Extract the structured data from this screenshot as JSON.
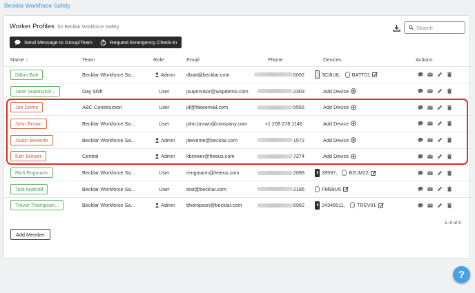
{
  "breadcrumb": "Becklar Workforce Safety",
  "card": {
    "title": "Worker Profiles",
    "subtitle": "for Becklar Workforce Safety",
    "send_message_label": "Send Message to Group/Team",
    "emergency_label": "Request Emergency Check-In",
    "search_placeholder": "Search"
  },
  "columns": {
    "name": "Name",
    "team": "Team",
    "role": "Role",
    "email": "Email",
    "phone": "Phone",
    "devices": "Devices",
    "actions": "Actions"
  },
  "add_device_label": "Add Device",
  "rows": [
    {
      "name": "Dillon Batt",
      "team": "Becklar Workforce Sa...",
      "role": "Admin",
      "email": "dbatt@becklar.com",
      "phone_suffix": "0092",
      "devices": [
        {
          "type": "tracker",
          "label": "3CI8U8,"
        },
        {
          "type": "tag",
          "label": "BATT01"
        }
      ],
      "highlight": false
    },
    {
      "name": "Jane Supervisor...",
      "team": "Day Shift",
      "role": "User",
      "email": "jsupervisor@wspdemo.com",
      "phone_suffix": "2303",
      "devices": [],
      "highlight": false
    },
    {
      "name": "Joe Demo",
      "team": "ABC Construction",
      "role": "User",
      "email": "jd@fakeemail.com",
      "phone_suffix": "5555",
      "devices": [],
      "highlight": true
    },
    {
      "name": "John Brown",
      "team": "Becklar Workforce Sa...",
      "role": "User",
      "email": "john.brown@company.com",
      "phone_full": "+1 208 278 1146",
      "devices": [],
      "highlight": true
    },
    {
      "name": "Justin Bevente",
      "team": "Becklar Workforce Sa...",
      "role": "Admin",
      "email": "jbevente@becklar.com",
      "phone_suffix": "1572",
      "devices": [],
      "highlight": true
    },
    {
      "name": "Ken Brower",
      "team": "Central",
      "role": "Admin",
      "email": "kbrower@freeus.com",
      "phone_suffix": "7274",
      "devices": [],
      "highlight": true
    },
    {
      "name": "Rich Engmann",
      "team": "Becklar Workforce Sa...",
      "role": "User",
      "email": "rengmann@freeus.com",
      "phone_suffix": "2098",
      "devices": [
        {
          "type": "tracker-dark",
          "label": "28597,"
        },
        {
          "type": "tag",
          "label": "B2UM22"
        }
      ],
      "highlight": false
    },
    {
      "name": "Test Android",
      "team": "Becklar Workforce Sa...",
      "role": "User",
      "email": "test@becklar.com",
      "phone_suffix": "2185",
      "devices": [
        {
          "type": "tag",
          "label": "FM99U5"
        }
      ],
      "highlight": false
    },
    {
      "name": "Trevor Thompson...",
      "team": "Becklar Workforce Sa...",
      "role": "Admin",
      "email": "tthompson@becklar.com",
      "phone_suffix": "6962",
      "devices": [
        {
          "type": "tracker-dark",
          "label": "24346011,"
        },
        {
          "type": "tag",
          "label": "TREV01"
        }
      ],
      "highlight": false
    }
  ],
  "pagination": "1–9 of 9",
  "add_member_label": "Add Member",
  "help_label": "?",
  "colors": {
    "accent": "#3d8fd6",
    "name_green": "#66b66a",
    "name_red": "#e06a50",
    "highlight": "#d72f23"
  }
}
